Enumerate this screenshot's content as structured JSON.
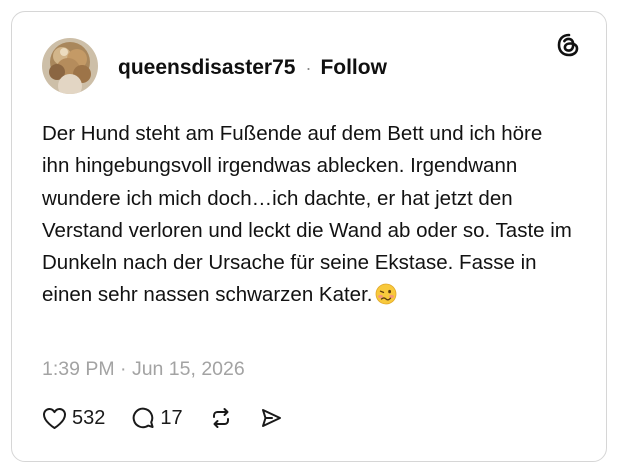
{
  "post": {
    "username": "queensdisaster75",
    "separator": "·",
    "follow_label": "Follow",
    "text": "Der Hund steht am Fußende auf dem Bett und ich höre ihn hingebungsvoll irgendwas ablecken. Irgendwann wundere ich mich doch…ich dachte, er hat jetzt den Verstand verloren und leckt die Wand ab oder so. Taste im Dunkeln nach der Ursache für seine Ekstase. Fasse in einen sehr nassen schwarzen Kater.",
    "emoji": "woozy-face",
    "timestamp": "1:39 PM · Jun 15, 2026"
  },
  "actions": {
    "likes": "532",
    "replies": "17"
  },
  "icons": {
    "brand": "threads-logo-icon",
    "like": "heart-icon",
    "reply": "speech-bubble-icon",
    "repost": "repost-icon",
    "share": "send-icon"
  }
}
